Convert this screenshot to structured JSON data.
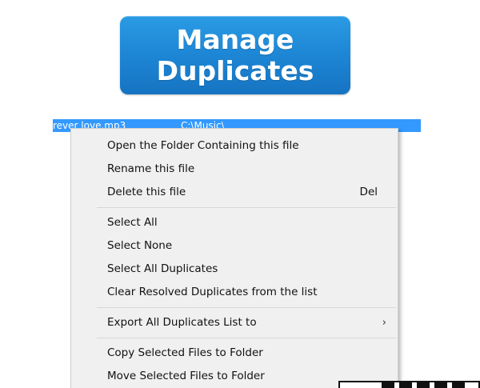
{
  "banner": {
    "text": "Manage\nDuplicates",
    "color": "#1c84d3"
  },
  "selected_row": {
    "file": "rever love.mp3",
    "path": "C:\\Music\\",
    "highlight_color": "#3399ff"
  },
  "context_menu": {
    "group1": [
      {
        "label": "Open the Folder Containing this file",
        "shortcut": ""
      },
      {
        "label": "Rename this file",
        "shortcut": ""
      },
      {
        "label": "Delete this file",
        "shortcut": "Del"
      }
    ],
    "group2": [
      {
        "label": "Select All"
      },
      {
        "label": "Select None"
      },
      {
        "label": "Select All Duplicates"
      },
      {
        "label": "Clear Resolved Duplicates from the list"
      }
    ],
    "group3": [
      {
        "label": "Export All Duplicates List to",
        "submenu_icon": "chevron-right-icon",
        "arrow": "›"
      }
    ],
    "group4": [
      {
        "label": "Copy Selected Files to Folder"
      },
      {
        "label": "Move Selected Files to Folder"
      }
    ]
  }
}
